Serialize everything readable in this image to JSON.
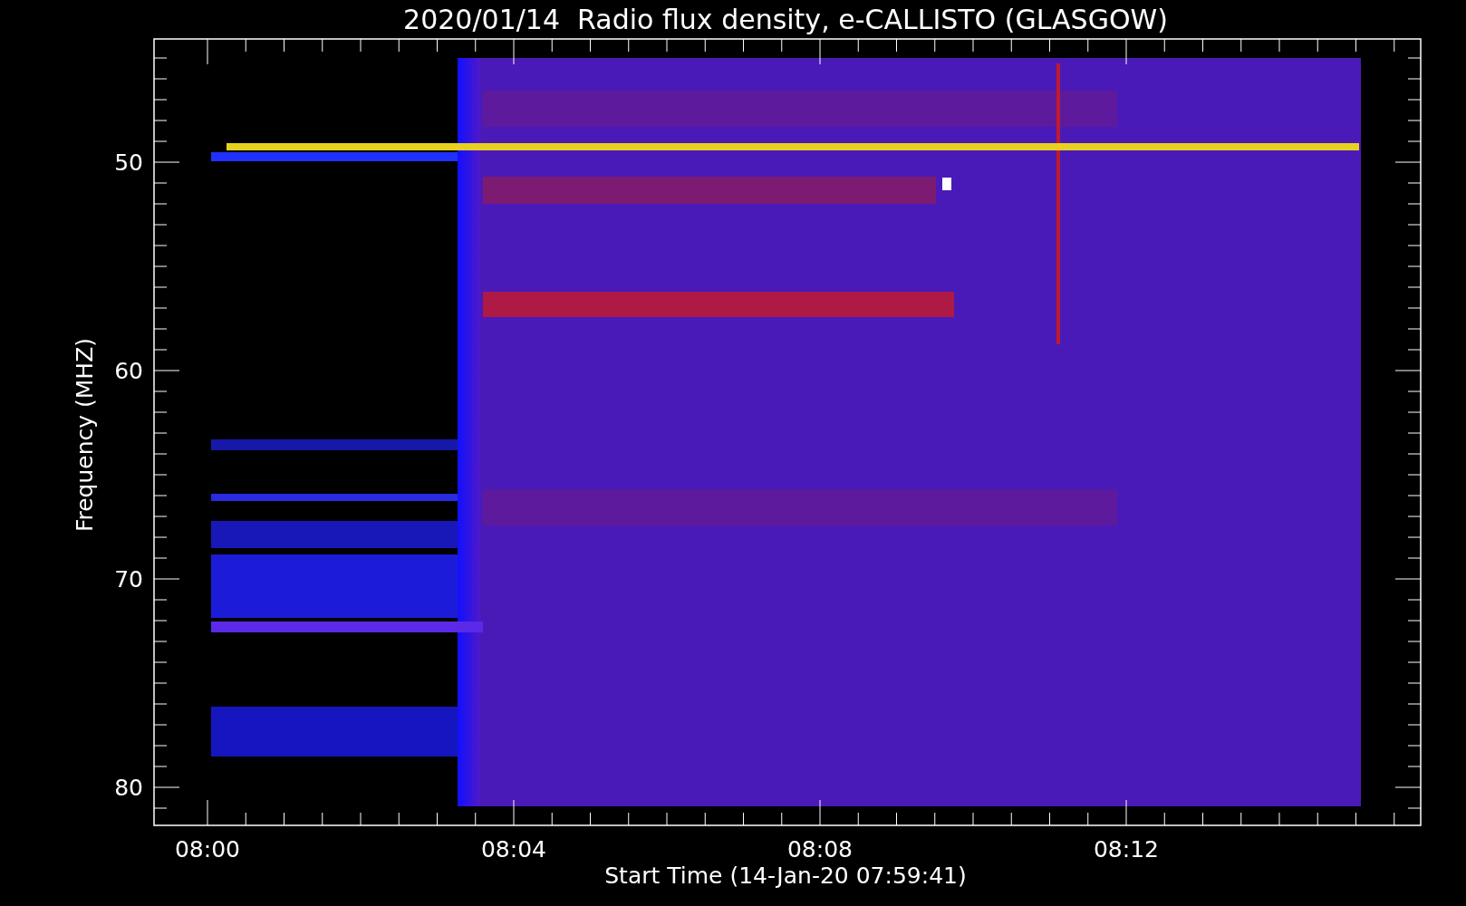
{
  "title": "2020/01/14  Radio flux density, e-CALLISTO (GLASGOW)",
  "y_axis": {
    "label": "Frequency (MHZ)",
    "ticks": [
      "50",
      "60",
      "70",
      "80"
    ]
  },
  "x_axis": {
    "label": "Start Time (14-Jan-20 07:59:41)",
    "ticks": [
      "08:00",
      "08:04",
      "08:08",
      "08:12"
    ]
  },
  "image": {
    "kind": "spectrogram"
  }
}
